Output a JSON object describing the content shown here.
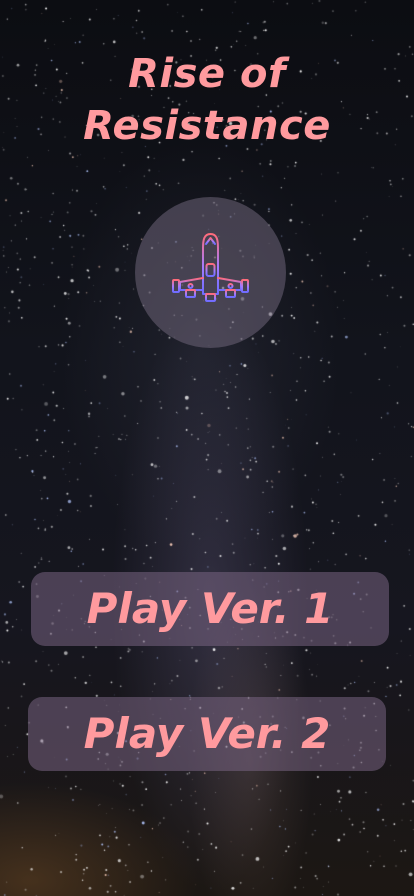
{
  "title": {
    "line1": "Rise of",
    "line2": "Resistance"
  },
  "logo": {
    "icon": "spaceship-icon"
  },
  "buttons": {
    "play_v1": "Play Ver. 1",
    "play_v2": "Play Ver. 2"
  },
  "colors": {
    "accent": "#ff9a9e",
    "ship_red": "#ff6b7a",
    "ship_blue": "#6f6cff",
    "ship_violet": "#a27bff"
  }
}
